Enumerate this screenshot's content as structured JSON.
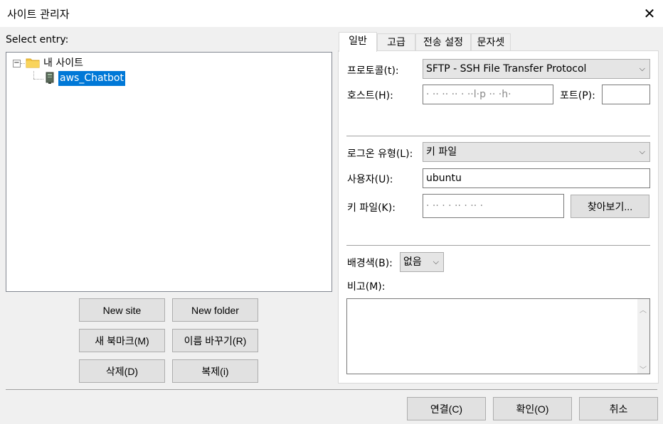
{
  "window": {
    "title": "사이트 관리자",
    "close": "✕"
  },
  "left": {
    "select_entry_label": "Select entry:",
    "tree": {
      "root_label": "내 사이트",
      "collapse_glyph": "−",
      "child_label": "aws_Chatbot"
    },
    "buttons": {
      "new_site": "New site",
      "new_folder": "New folder",
      "new_bookmark": "새 북마크(M)",
      "rename": "이름 바꾸기(R)",
      "delete": "삭제(D)",
      "duplicate": "복제(i)"
    }
  },
  "tabs": [
    {
      "label": "일반"
    },
    {
      "label": "고급"
    },
    {
      "label": "전송 설정"
    },
    {
      "label": "문자셋"
    }
  ],
  "general": {
    "protocol_label": "프로토콜(t):",
    "protocol_value": "SFTP - SSH File Transfer Protocol",
    "host_label": "호스트(H):",
    "host_value": "· ·· ·· ·· ·  ··l·p     ·· ·h·",
    "port_label": "포트(P):",
    "port_value": "",
    "logon_label": "로그온 유형(L):",
    "logon_value": "키 파일",
    "user_label": "사용자(U):",
    "user_value": "ubuntu",
    "keyfile_label": "키 파일(K):",
    "keyfile_value": "·                     ·· · · ·· · ·· ·",
    "browse_button": "찾아보기...",
    "bgcolor_label": "배경색(B):",
    "bgcolor_value": "없음",
    "comment_label": "비고(M):",
    "comment_value": ""
  },
  "footer": {
    "connect": "연결(C)",
    "ok": "확인(O)",
    "cancel": "취소"
  },
  "colors": {
    "selection": "#0078d7",
    "folder": "#f4c542",
    "button_bg": "#e1e1e1"
  }
}
